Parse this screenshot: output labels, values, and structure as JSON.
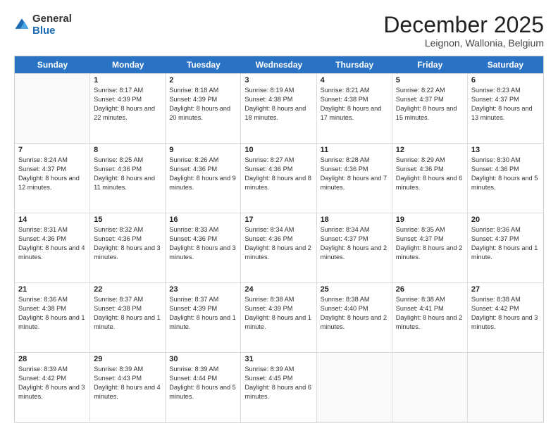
{
  "logo": {
    "general": "General",
    "blue": "Blue"
  },
  "header": {
    "month": "December 2025",
    "location": "Leignon, Wallonia, Belgium"
  },
  "days_of_week": [
    "Sunday",
    "Monday",
    "Tuesday",
    "Wednesday",
    "Thursday",
    "Friday",
    "Saturday"
  ],
  "weeks": [
    [
      {
        "day": "",
        "sunrise": "",
        "sunset": "",
        "daylight": ""
      },
      {
        "day": "1",
        "sunrise": "Sunrise: 8:17 AM",
        "sunset": "Sunset: 4:39 PM",
        "daylight": "Daylight: 8 hours and 22 minutes."
      },
      {
        "day": "2",
        "sunrise": "Sunrise: 8:18 AM",
        "sunset": "Sunset: 4:39 PM",
        "daylight": "Daylight: 8 hours and 20 minutes."
      },
      {
        "day": "3",
        "sunrise": "Sunrise: 8:19 AM",
        "sunset": "Sunset: 4:38 PM",
        "daylight": "Daylight: 8 hours and 18 minutes."
      },
      {
        "day": "4",
        "sunrise": "Sunrise: 8:21 AM",
        "sunset": "Sunset: 4:38 PM",
        "daylight": "Daylight: 8 hours and 17 minutes."
      },
      {
        "day": "5",
        "sunrise": "Sunrise: 8:22 AM",
        "sunset": "Sunset: 4:37 PM",
        "daylight": "Daylight: 8 hours and 15 minutes."
      },
      {
        "day": "6",
        "sunrise": "Sunrise: 8:23 AM",
        "sunset": "Sunset: 4:37 PM",
        "daylight": "Daylight: 8 hours and 13 minutes."
      }
    ],
    [
      {
        "day": "7",
        "sunrise": "Sunrise: 8:24 AM",
        "sunset": "Sunset: 4:37 PM",
        "daylight": "Daylight: 8 hours and 12 minutes."
      },
      {
        "day": "8",
        "sunrise": "Sunrise: 8:25 AM",
        "sunset": "Sunset: 4:36 PM",
        "daylight": "Daylight: 8 hours and 11 minutes."
      },
      {
        "day": "9",
        "sunrise": "Sunrise: 8:26 AM",
        "sunset": "Sunset: 4:36 PM",
        "daylight": "Daylight: 8 hours and 9 minutes."
      },
      {
        "day": "10",
        "sunrise": "Sunrise: 8:27 AM",
        "sunset": "Sunset: 4:36 PM",
        "daylight": "Daylight: 8 hours and 8 minutes."
      },
      {
        "day": "11",
        "sunrise": "Sunrise: 8:28 AM",
        "sunset": "Sunset: 4:36 PM",
        "daylight": "Daylight: 8 hours and 7 minutes."
      },
      {
        "day": "12",
        "sunrise": "Sunrise: 8:29 AM",
        "sunset": "Sunset: 4:36 PM",
        "daylight": "Daylight: 8 hours and 6 minutes."
      },
      {
        "day": "13",
        "sunrise": "Sunrise: 8:30 AM",
        "sunset": "Sunset: 4:36 PM",
        "daylight": "Daylight: 8 hours and 5 minutes."
      }
    ],
    [
      {
        "day": "14",
        "sunrise": "Sunrise: 8:31 AM",
        "sunset": "Sunset: 4:36 PM",
        "daylight": "Daylight: 8 hours and 4 minutes."
      },
      {
        "day": "15",
        "sunrise": "Sunrise: 8:32 AM",
        "sunset": "Sunset: 4:36 PM",
        "daylight": "Daylight: 8 hours and 3 minutes."
      },
      {
        "day": "16",
        "sunrise": "Sunrise: 8:33 AM",
        "sunset": "Sunset: 4:36 PM",
        "daylight": "Daylight: 8 hours and 3 minutes."
      },
      {
        "day": "17",
        "sunrise": "Sunrise: 8:34 AM",
        "sunset": "Sunset: 4:36 PM",
        "daylight": "Daylight: 8 hours and 2 minutes."
      },
      {
        "day": "18",
        "sunrise": "Sunrise: 8:34 AM",
        "sunset": "Sunset: 4:37 PM",
        "daylight": "Daylight: 8 hours and 2 minutes."
      },
      {
        "day": "19",
        "sunrise": "Sunrise: 8:35 AM",
        "sunset": "Sunset: 4:37 PM",
        "daylight": "Daylight: 8 hours and 2 minutes."
      },
      {
        "day": "20",
        "sunrise": "Sunrise: 8:36 AM",
        "sunset": "Sunset: 4:37 PM",
        "daylight": "Daylight: 8 hours and 1 minute."
      }
    ],
    [
      {
        "day": "21",
        "sunrise": "Sunrise: 8:36 AM",
        "sunset": "Sunset: 4:38 PM",
        "daylight": "Daylight: 8 hours and 1 minute."
      },
      {
        "day": "22",
        "sunrise": "Sunrise: 8:37 AM",
        "sunset": "Sunset: 4:38 PM",
        "daylight": "Daylight: 8 hours and 1 minute."
      },
      {
        "day": "23",
        "sunrise": "Sunrise: 8:37 AM",
        "sunset": "Sunset: 4:39 PM",
        "daylight": "Daylight: 8 hours and 1 minute."
      },
      {
        "day": "24",
        "sunrise": "Sunrise: 8:38 AM",
        "sunset": "Sunset: 4:39 PM",
        "daylight": "Daylight: 8 hours and 1 minute."
      },
      {
        "day": "25",
        "sunrise": "Sunrise: 8:38 AM",
        "sunset": "Sunset: 4:40 PM",
        "daylight": "Daylight: 8 hours and 2 minutes."
      },
      {
        "day": "26",
        "sunrise": "Sunrise: 8:38 AM",
        "sunset": "Sunset: 4:41 PM",
        "daylight": "Daylight: 8 hours and 2 minutes."
      },
      {
        "day": "27",
        "sunrise": "Sunrise: 8:38 AM",
        "sunset": "Sunset: 4:42 PM",
        "daylight": "Daylight: 8 hours and 3 minutes."
      }
    ],
    [
      {
        "day": "28",
        "sunrise": "Sunrise: 8:39 AM",
        "sunset": "Sunset: 4:42 PM",
        "daylight": "Daylight: 8 hours and 3 minutes."
      },
      {
        "day": "29",
        "sunrise": "Sunrise: 8:39 AM",
        "sunset": "Sunset: 4:43 PM",
        "daylight": "Daylight: 8 hours and 4 minutes."
      },
      {
        "day": "30",
        "sunrise": "Sunrise: 8:39 AM",
        "sunset": "Sunset: 4:44 PM",
        "daylight": "Daylight: 8 hours and 5 minutes."
      },
      {
        "day": "31",
        "sunrise": "Sunrise: 8:39 AM",
        "sunset": "Sunset: 4:45 PM",
        "daylight": "Daylight: 8 hours and 6 minutes."
      },
      {
        "day": "",
        "sunrise": "",
        "sunset": "",
        "daylight": ""
      },
      {
        "day": "",
        "sunrise": "",
        "sunset": "",
        "daylight": ""
      },
      {
        "day": "",
        "sunrise": "",
        "sunset": "",
        "daylight": ""
      }
    ]
  ]
}
